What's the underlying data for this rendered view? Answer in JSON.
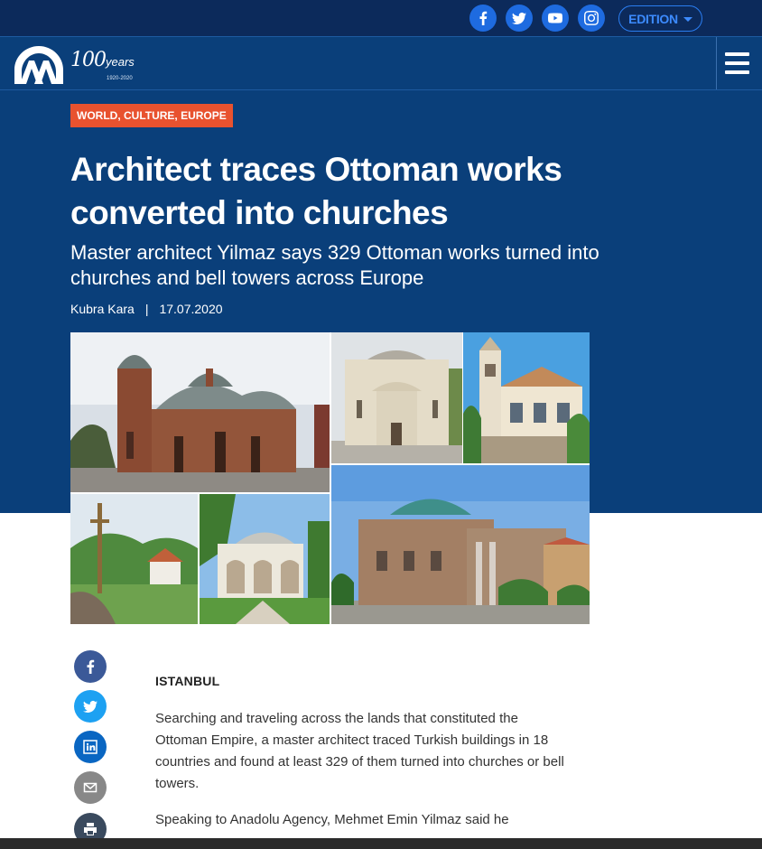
{
  "topbar": {
    "social": [
      {
        "name": "facebook-icon"
      },
      {
        "name": "twitter-icon"
      },
      {
        "name": "youtube-icon"
      },
      {
        "name": "instagram-icon"
      }
    ],
    "edition_label": "EDITION"
  },
  "header": {
    "logo_text": "AA",
    "logo_years_big": "100",
    "logo_years_small": "years",
    "logo_range": "1920-2020"
  },
  "article": {
    "categories": "WORLD, CULTURE, EUROPE",
    "title": "Architect traces Ottoman works converted into churches",
    "subtitle": "Master architect Yilmaz says 329 Ottoman works turned into churches and bell towers across Europe",
    "author": "Kubra Kara",
    "separator": "|",
    "date": "17.07.2020",
    "dateline": "ISTANBUL",
    "paragraphs": [
      "Searching and traveling across the lands that constituted the Ottoman Empire, a master architect traced Turkish buildings in 18 countries and found at least 329 of them turned into churches or bell towers.",
      "Speaking to Anadolu Agency, Mehmet Emin Yilmaz said he"
    ]
  },
  "share": [
    "facebook-icon",
    "twitter-icon",
    "linkedin-icon",
    "mail-icon",
    "print-icon"
  ],
  "colors": {
    "topbar": "#0c2a5b",
    "header": "#0a3f7a",
    "category_badge": "#e8522f",
    "facebook": "#3b5998",
    "twitter": "#1da1f2",
    "linkedin": "#0a66c2",
    "mail": "#888888",
    "print": "#3a4a5e"
  }
}
